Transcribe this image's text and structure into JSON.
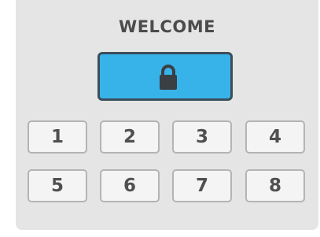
{
  "screen": {
    "title": "WELCOME"
  },
  "lock_button": {
    "icon": "lock-icon",
    "color": "#37b3ea",
    "border_color": "#3b4e5c"
  },
  "keypad": {
    "keys": [
      "1",
      "2",
      "3",
      "4",
      "5",
      "6",
      "7",
      "8"
    ]
  },
  "colors": {
    "panel_background": "#e5e5e5",
    "key_background": "#f4f4f4",
    "key_border": "#b4b4b4",
    "text": "#4b4b4b"
  }
}
